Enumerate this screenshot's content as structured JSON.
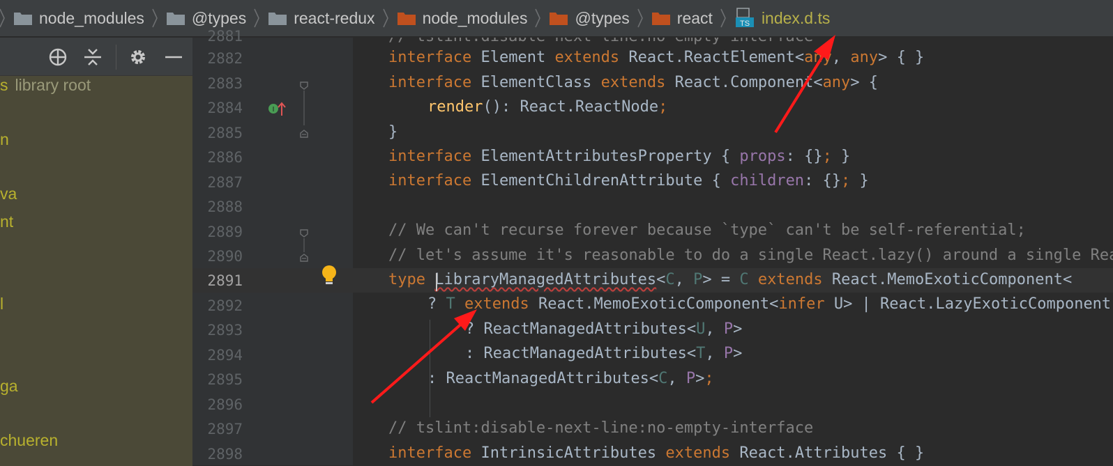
{
  "breadcrumbs": [
    {
      "label": "node_modules",
      "folder_color": "#8a949b"
    },
    {
      "label": "@types",
      "folder_color": "#8a949b"
    },
    {
      "label": "react-redux",
      "folder_color": "#8a949b"
    },
    {
      "label": "node_modules",
      "folder_color": "#c0501e"
    },
    {
      "label": "@types",
      "folder_color": "#c0501e"
    },
    {
      "label": "react",
      "folder_color": "#c0501e"
    }
  ],
  "file": {
    "label": "index.d.ts",
    "icon_text": "TS"
  },
  "tree": {
    "items": [
      {
        "text": "s",
        "extra": "library root"
      },
      {
        "text": "n",
        "extra": ""
      },
      {
        "text": "va",
        "extra": ""
      },
      {
        "text": "nt",
        "extra": ""
      },
      {
        "text": "l",
        "extra": ""
      },
      {
        "text": "ga",
        "extra": ""
      },
      {
        "text": "chueren",
        "extra": ""
      }
    ]
  },
  "editor": {
    "line_numbers": [
      "2881",
      "2882",
      "2883",
      "2884",
      "2885",
      "2886",
      "2887",
      "2888",
      "2889",
      "2890",
      "2891",
      "2892",
      "2893",
      "2894",
      "2895",
      "2896",
      "2897",
      "2898"
    ],
    "current_line": "2891",
    "lines": {
      "l2881": "// tslint:disable-next-line:no-empty-interface",
      "l2882": [
        "interface",
        "Element",
        "extends",
        "React.ReactElement<",
        "any",
        ", ",
        "any",
        "> { }"
      ],
      "l2883": [
        "interface",
        "ElementClass",
        "extends",
        "React.Component<",
        "any",
        "> {"
      ],
      "l2884": [
        "render",
        "(): React.ReactNode",
        ";"
      ],
      "l2885": "}",
      "l2886": [
        "interface",
        "ElementAttributesProperty { ",
        "props",
        ": {}",
        ";",
        " }"
      ],
      "l2887": [
        "interface",
        "ElementChildrenAttribute { ",
        "children",
        ": {}",
        ";",
        " }"
      ],
      "l2889": "// We can't recurse forever because `type` can't be self-referential;",
      "l2890": "// let's assume it's reasonable to do a single React.lazy() around a single React.memo() / vice-versa",
      "l2891": [
        "type",
        "LibraryManagedAttributes",
        "<",
        "C",
        ", ",
        "P",
        "> = ",
        "C",
        "extends",
        "React.MemoExoticComponent<"
      ],
      "l2892": [
        "? ",
        "T",
        "extends",
        "React.MemoExoticComponent<",
        "infer",
        " U> | React.LazyExoticComponent"
      ],
      "l2893": [
        "? ReactManagedAttributes<",
        "U",
        ", ",
        "P",
        ">"
      ],
      "l2894": [
        ": ReactManagedAttributes<",
        "T",
        ", ",
        "P",
        ">"
      ],
      "l2895": [
        ": ReactManagedAttributes<",
        "C",
        ", ",
        "P",
        ">",
        ";"
      ],
      "l2897": "// tslint:disable-next-line:no-empty-interface",
      "l2898": [
        "interface",
        "IntrinsicAttributes",
        "extends",
        "React.Attributes { }"
      ]
    }
  },
  "colors": {
    "keyword": "#cc7832",
    "type_param": "#507874",
    "property": "#9876aa",
    "function": "#ffc66d",
    "comment": "#808080",
    "arrow": "#ff1a1a"
  },
  "icons": [
    "target-icon",
    "collapse-icon",
    "gear-icon",
    "minimize-icon",
    "lightbulb-icon",
    "implements-icon"
  ]
}
